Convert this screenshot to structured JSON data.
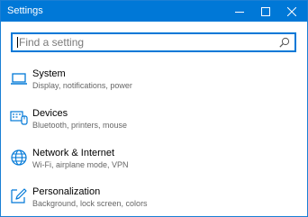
{
  "window": {
    "title": "Settings"
  },
  "titlebar_buttons": {
    "minimize": "minimize-icon",
    "maximize": "maximize-icon",
    "close": "close-icon"
  },
  "search": {
    "placeholder": "Find a setting",
    "icon": "search-icon"
  },
  "items": [
    {
      "icon": "laptop-icon",
      "label": "System",
      "description": "Display, notifications, power"
    },
    {
      "icon": "devices-icon",
      "label": "Devices",
      "description": "Bluetooth, printers, mouse"
    },
    {
      "icon": "globe-icon",
      "label": "Network & Internet",
      "description": "Wi-Fi, airplane mode, VPN"
    },
    {
      "icon": "pen-icon",
      "label": "Personalization",
      "description": "Background, lock screen, colors"
    }
  ],
  "colors": {
    "accent": "#0078d7",
    "text": "#000000",
    "subtext": "#666666"
  }
}
